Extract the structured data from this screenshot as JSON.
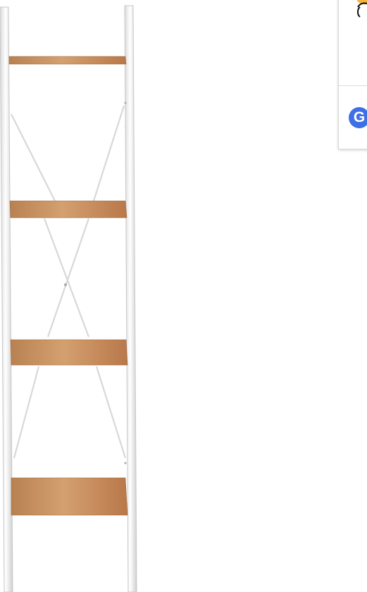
{
  "product": {
    "image_description_icon": "ladder-shelf-product-image",
    "shelf_count": 4,
    "colors": {
      "frame": "#f2f2f2",
      "frame_shadow": "#c9c9c9",
      "wood": "#c99361",
      "wood_dark": "#a86f45"
    }
  },
  "popup": {
    "google_icon_text": "G",
    "colors": {
      "google_blue": "#3f6fe6",
      "border": "#d7d7d7",
      "illustration": "#f4b33f"
    }
  }
}
